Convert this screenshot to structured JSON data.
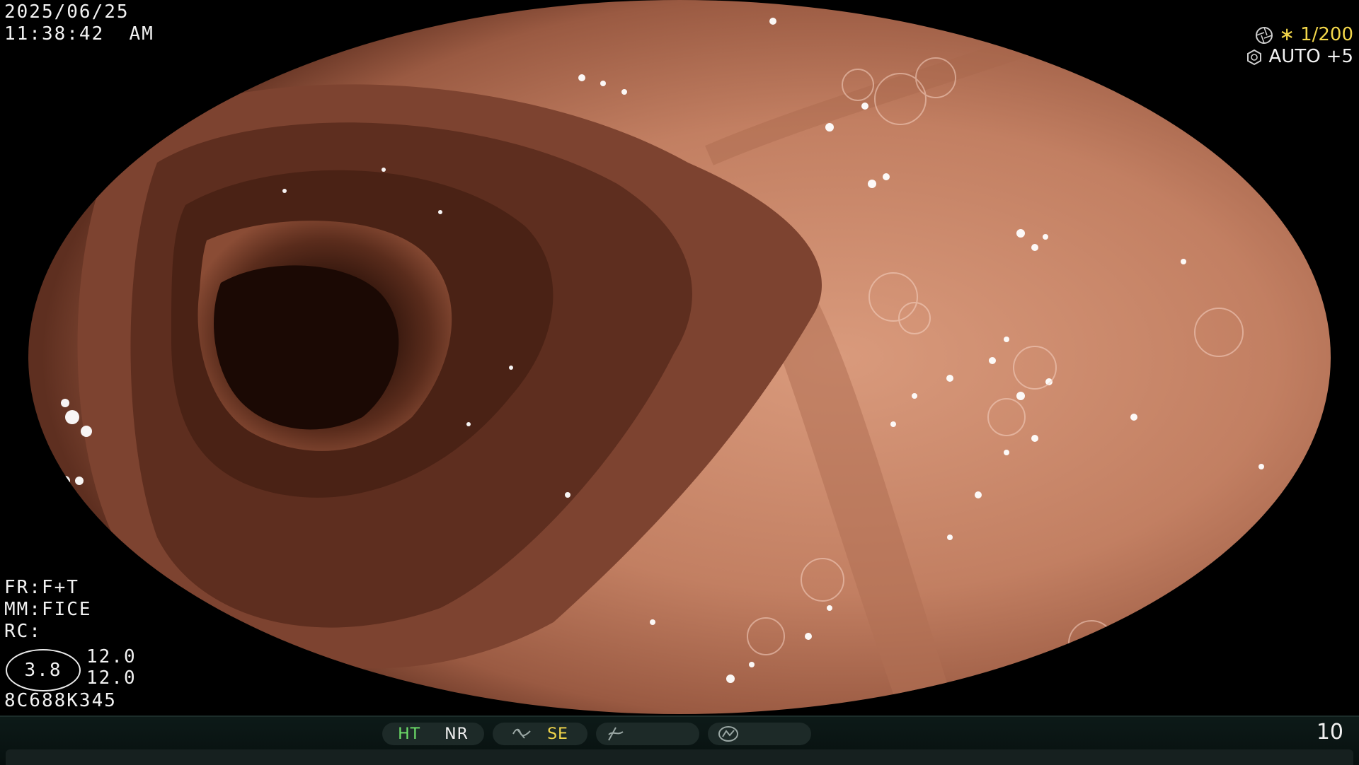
{
  "header": {
    "date": "2025/06/25",
    "time": "11:38:42  AM"
  },
  "exposure": {
    "shutter_prefix": "∗",
    "shutter": "1/200",
    "mode": "AUTO",
    "mode_value": "+5",
    "shutter_icon": "aperture-icon",
    "mode_icon": "iris-icon"
  },
  "settings": {
    "fr": "FR:F+T",
    "mm": "MM:FICE",
    "rc": "RC:",
    "ellipse_value": "3.8",
    "value_1": "12.0",
    "value_2": "12.0",
    "serial": "8C688K345"
  },
  "status_bar": {
    "ht": "HT",
    "nr": "NR",
    "se": "SE",
    "icons": [
      "wave-icon",
      "slash-curve-icon",
      "gauge-icon"
    ],
    "page_number": "10"
  },
  "colors": {
    "mucosa": "#c98a6e",
    "lumen": "#2a1108",
    "accent_yellow": "#f2d64a",
    "accent_green": "#6ee06a"
  }
}
